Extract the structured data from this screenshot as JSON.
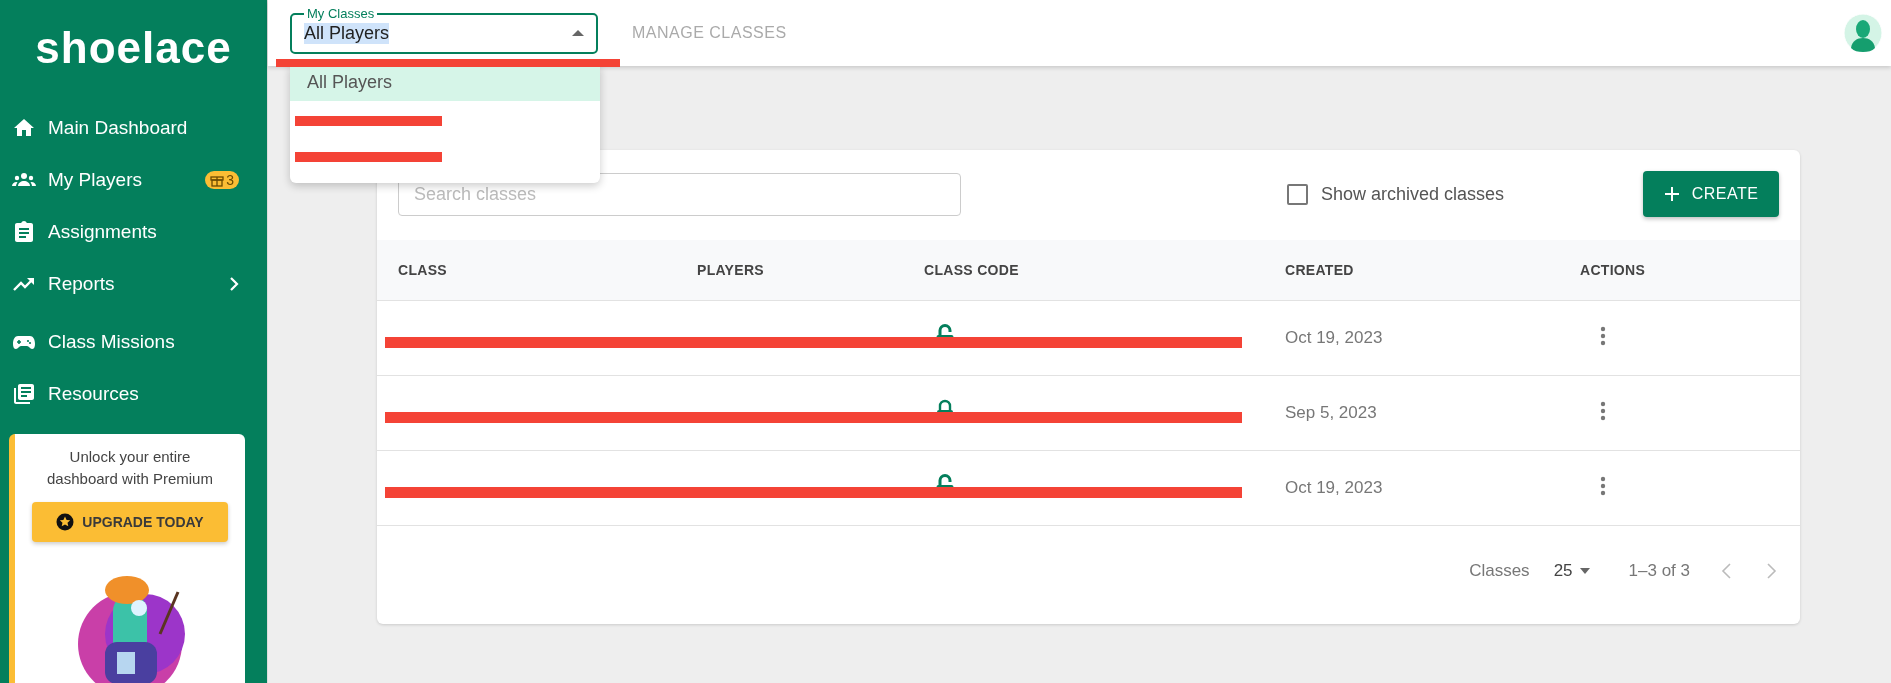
{
  "sidebar": {
    "logo": "shoelace",
    "items": [
      {
        "label": "Main Dashboard"
      },
      {
        "label": "My Players",
        "badge": "3"
      },
      {
        "label": "Assignments"
      },
      {
        "label": "Reports",
        "has_submenu": true
      },
      {
        "label": "Class Missions"
      },
      {
        "label": "Resources"
      }
    ],
    "promo": {
      "text": "Unlock your entire dashboard with Premium",
      "button": "UPGRADE TODAY"
    }
  },
  "topbar": {
    "class_select": {
      "label": "My Classes",
      "value": "All Players",
      "expanded": true,
      "redacted": true
    },
    "tab": "MANAGE CLASSES",
    "options": [
      {
        "label": "All Players",
        "selected": true,
        "redacted": false
      },
      {
        "selected": false,
        "redacted": true
      },
      {
        "selected": false,
        "redacted": true
      }
    ]
  },
  "toolbar": {
    "search": {
      "placeholder": "Search classes"
    },
    "show_archived": {
      "label": "Show archived classes",
      "checked": false
    },
    "create_button": "CREATE"
  },
  "table": {
    "columns": [
      "CLASS",
      "PLAYERS",
      "CLASS CODE",
      "CREATED",
      "ACTIONS"
    ],
    "rows": [
      {
        "locked": false,
        "created": "Oct 19, 2023",
        "redacted": true
      },
      {
        "locked": true,
        "created": "Sep 5, 2023",
        "redacted": true
      },
      {
        "locked": false,
        "created": "Oct 19, 2023",
        "redacted": true
      }
    ]
  },
  "pagination": {
    "label": "Classes",
    "per_page": "25",
    "range": "1–3 of 3"
  }
}
